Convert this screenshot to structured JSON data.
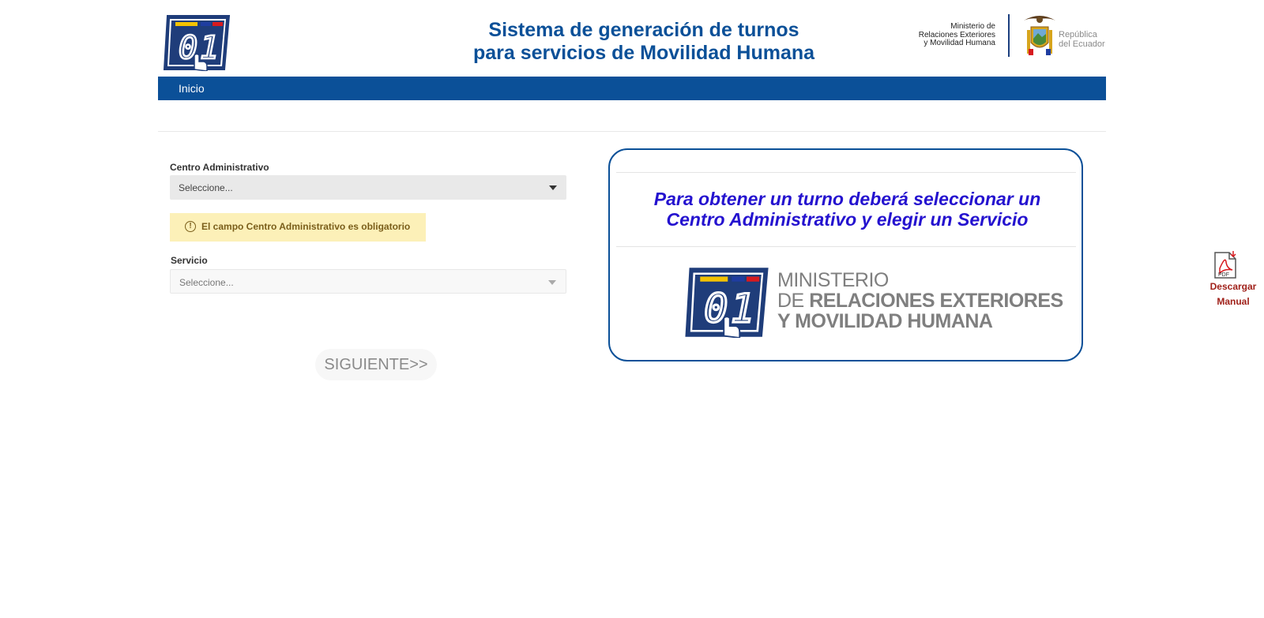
{
  "header": {
    "title_line1": "Sistema de generación de turnos",
    "title_line2": "para servicios de Movilidad Humana",
    "ministry_line1": "Ministerio de",
    "ministry_line2": "Relaciones Exteriores",
    "ministry_line3": "y Movilidad Humana",
    "republica_line1": "República",
    "republica_line2": "del Ecuador"
  },
  "nav": {
    "home_label": "Inicio"
  },
  "form": {
    "centro_label": "Centro Administrativo",
    "centro_value": "Seleccione...",
    "alert_text": "El campo Centro Administrativo es obligatorio",
    "servicio_label": "Servicio",
    "servicio_value": "Seleccione...",
    "next_label": "SIGUIENTE>>"
  },
  "info": {
    "line1": "Para obtener un turno deberá seleccionar un",
    "line2": "Centro Administrativo y elegir un Servicio",
    "ministry_line1": "MINISTERIO",
    "ministry_line2_prefix": "DE ",
    "ministry_line2_bold": "RELACIONES EXTERIORES",
    "ministry_line3": "Y MOVILIDAD HUMANA"
  },
  "pdf": {
    "icon_text": "PDF",
    "label_line1": "Descargar",
    "label_line2": "Manual"
  },
  "colors": {
    "brand_blue": "#0b5098",
    "info_text": "#2412cf",
    "alert_bg": "#fcf0b8",
    "pdf_red": "#a0211a"
  }
}
